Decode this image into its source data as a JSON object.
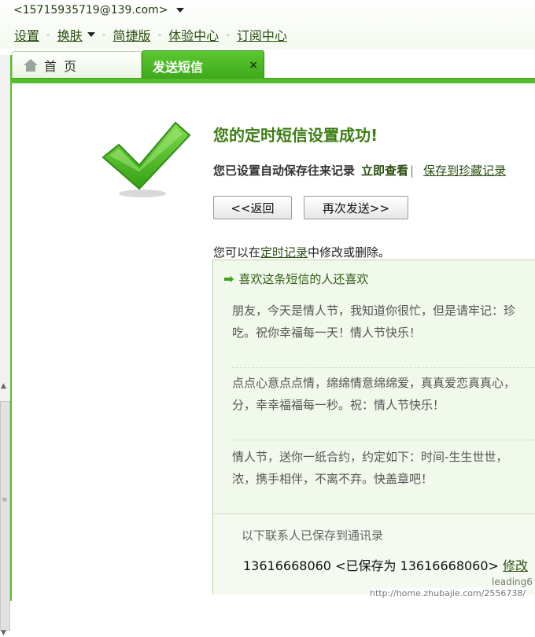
{
  "header": {
    "account": "<15715935719@139.com>",
    "nav": {
      "settings": "设置",
      "skin": "换肤",
      "simple": "简捷版",
      "experience": "体验中心",
      "subscribe": "订阅中心",
      "separator": "-"
    }
  },
  "tabs": {
    "home": "首 页",
    "send_sms": "发送短信",
    "close_symbol": "×"
  },
  "result": {
    "title": "您的定时短信设置成功!",
    "autosave_note": "您已设置自动保存往来记录",
    "view_now": "立即查看",
    "separator": "|",
    "save_favorites": "保存到珍藏记录",
    "back_button": "<<返回",
    "send_again_button": "再次发送>>",
    "modify_prefix": "您可以在",
    "modify_link": "定时记录",
    "modify_suffix": "中修改或删除。"
  },
  "recommend": {
    "icon": "arrow-right-icon",
    "heading": "喜欢这条短信的人还喜欢",
    "messages": [
      {
        "line1": "朋友，今天是情人节，我知道你很忙，但是请牢记：珍",
        "line2": "吃。祝你幸福每一天！情人节快乐！"
      },
      {
        "line1": "点点心意点点情，绵绵情意绵绵爱，真真爱恋真真心，",
        "line2": "分，幸幸福福每一秒。祝：情人节快乐！"
      },
      {
        "line1": "情人节，送你一纸合约，约定如下：时间-生生世世，",
        "line2": "浓，携手相伴，不离不弃。快盖章吧！"
      }
    ]
  },
  "contacts": {
    "title": "以下联系人已保存到通讯录",
    "entry": "13616668060 <已保存为 13616668060>",
    "edit": "修改"
  },
  "watermark": {
    "line1": "leading6",
    "line2": "http://home.zhubajie.com/2556738/"
  },
  "colors": {
    "accent": "#55bd2b",
    "title_green": "#3c7d14",
    "link_green": "#2b4e12",
    "panel_bg": "#f1f8ec"
  }
}
